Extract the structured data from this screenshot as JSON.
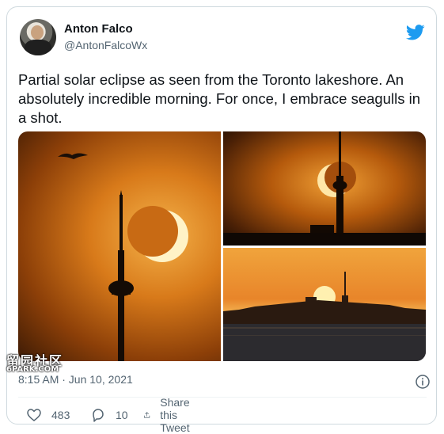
{
  "tweet": {
    "author_name": "Anton Falco",
    "author_handle": "@AntonFalcoWx",
    "text": "Partial solar eclipse as seen from the Toronto lakeshore. An absolutely incredible morning. For once, I embrace seagulls in a shot.",
    "timestamp": "8:15 AM · Jun 10, 2021",
    "likes": "483",
    "replies": "10",
    "share_label": "Share this Tweet"
  },
  "watermark": {
    "text": "留园社区",
    "subtext": "6PARK.COM"
  },
  "icons": {
    "brand": "twitter-bird-icon",
    "info": "info-icon",
    "like": "heart-icon",
    "reply": "reply-icon",
    "share": "share-icon"
  },
  "colors": {
    "brand_blue": "#1d9bf0",
    "text_primary": "#0f1419",
    "text_secondary": "#536471"
  }
}
